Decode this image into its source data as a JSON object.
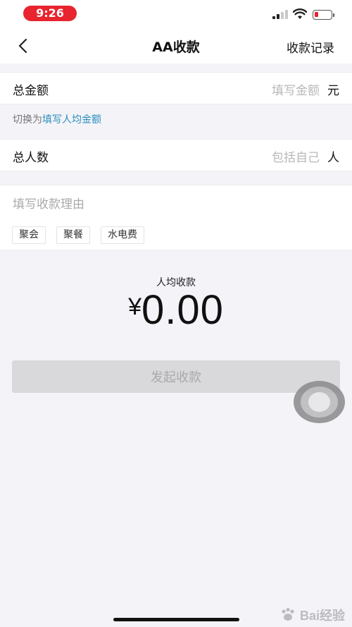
{
  "status_bar": {
    "time": "9:26",
    "accent": "#e8242f"
  },
  "nav": {
    "title": "AA收款",
    "right_link": "收款记录",
    "back_icon": "chevron-left-icon"
  },
  "form": {
    "total_amount": {
      "label": "总金额",
      "placeholder": "填写金额",
      "unit": "元"
    },
    "switch_mode": {
      "prefix": "切换为",
      "link": "填写人均金额",
      "link_color": "#2a8fbd"
    },
    "people_count": {
      "label": "总人数",
      "placeholder": "包括自己",
      "unit": "人"
    },
    "reason": {
      "placeholder": "填写收款理由",
      "tags": [
        "聚会",
        "聚餐",
        "水电费"
      ]
    }
  },
  "summary": {
    "label": "人均收款",
    "currency": "¥",
    "amount": "0.00"
  },
  "submit": {
    "label": "发起收款"
  },
  "watermark": {
    "text": "Bai经验"
  }
}
